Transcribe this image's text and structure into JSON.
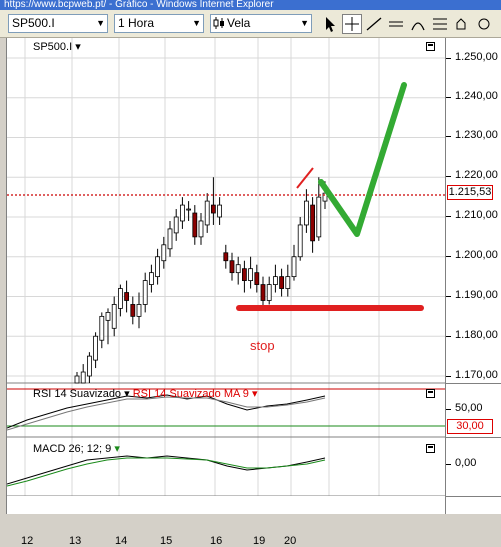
{
  "window": {
    "title": "https://www.bcpweb.pt/ - Gráfico - Windows Internet Explorer"
  },
  "toolbar": {
    "symbol_value": "SP500.I",
    "interval_value": "1 Hora",
    "chart_type_value": "Vela",
    "icons": [
      "cursor-icon",
      "crosshair-icon",
      "trendline-icon",
      "horizontal-line-icon",
      "text-icon",
      "fibonacci-icon",
      "settings-icon"
    ]
  },
  "price_pane": {
    "symbol_label": "SP500.I",
    "y_labels": [
      "1.250,00",
      "1.240,00",
      "1.230,00",
      "1.220,00",
      "1.210,00",
      "1.200,00",
      "1.190,00",
      "1.180,00",
      "1.170,00"
    ],
    "last_price": "1.215,53",
    "annotation": "stop",
    "colors": {
      "up_candle": "#ffffff",
      "down_candle": "#8b0000",
      "wick": "#000000",
      "price_line": "#cc0000",
      "stop_line": "#e02020",
      "arrow": "#33aa33"
    }
  },
  "rsi_pane": {
    "label_1": "RSI 14 Suavizado",
    "label_2": "RSI 14 Suavizado MA 9",
    "y_labels": [
      "50,00"
    ],
    "level_value": "30,00",
    "level_color": "#1a8a1a"
  },
  "macd_pane": {
    "label": "MACD 26; 12; 9",
    "y_labels": [
      "0,00"
    ]
  },
  "x_axis": {
    "labels": [
      "12",
      "13",
      "14",
      "15",
      "16",
      "19",
      "20"
    ]
  },
  "chart_data": {
    "type": "candlestick",
    "ylim": [
      1167,
      1255
    ],
    "yticks": [
      1170,
      1180,
      1190,
      1200,
      1210,
      1220,
      1230,
      1240,
      1250
    ],
    "last_price": 1215.53,
    "candles": [
      [
        1165,
        1170,
        1163,
        1171
      ],
      [
        1168,
        1171,
        1166,
        1173
      ],
      [
        1170,
        1175,
        1168,
        1176
      ],
      [
        1174,
        1180,
        1172,
        1181
      ],
      [
        1179,
        1185,
        1177,
        1186
      ],
      [
        1184,
        1186,
        1178,
        1187
      ],
      [
        1182,
        1188,
        1180,
        1190
      ],
      [
        1187,
        1192,
        1185,
        1193
      ],
      [
        1191,
        1189,
        1186,
        1194
      ],
      [
        1188,
        1185,
        1183,
        1190
      ],
      [
        1185,
        1188,
        1182,
        1191
      ],
      [
        1188,
        1194,
        1186,
        1196
      ],
      [
        1193,
        1196,
        1191,
        1198
      ],
      [
        1195,
        1200,
        1193,
        1202
      ],
      [
        1199,
        1203,
        1197,
        1205
      ],
      [
        1202,
        1207,
        1200,
        1209
      ],
      [
        1206,
        1210,
        1204,
        1212
      ],
      [
        1209,
        1213,
        1207,
        1215
      ],
      [
        1212,
        1212,
        1209,
        1214
      ],
      [
        1211,
        1205,
        1203,
        1213
      ],
      [
        1205,
        1209,
        1203,
        1211
      ],
      [
        1208,
        1214,
        1206,
        1216
      ],
      [
        1213,
        1211,
        1208,
        1220
      ],
      [
        1210,
        1213,
        1208,
        1215
      ],
      [
        1201,
        1199,
        1197,
        1203
      ],
      [
        1199,
        1196,
        1194,
        1201
      ],
      [
        1196,
        1198,
        1193,
        1200
      ],
      [
        1197,
        1194,
        1191,
        1199
      ],
      [
        1194,
        1197,
        1192,
        1200
      ],
      [
        1196,
        1193,
        1191,
        1198
      ],
      [
        1193,
        1189,
        1187,
        1195
      ],
      [
        1189,
        1193,
        1188,
        1195
      ],
      [
        1193,
        1195,
        1191,
        1198
      ],
      [
        1195,
        1192,
        1190,
        1197
      ],
      [
        1192,
        1195,
        1190,
        1198
      ],
      [
        1195,
        1200,
        1194,
        1203
      ],
      [
        1200,
        1208,
        1199,
        1210
      ],
      [
        1208,
        1214,
        1206,
        1217
      ],
      [
        1213,
        1204,
        1201,
        1215
      ],
      [
        1205,
        1215,
        1204,
        1220
      ],
      [
        1214,
        1216,
        1212,
        1219
      ]
    ]
  }
}
